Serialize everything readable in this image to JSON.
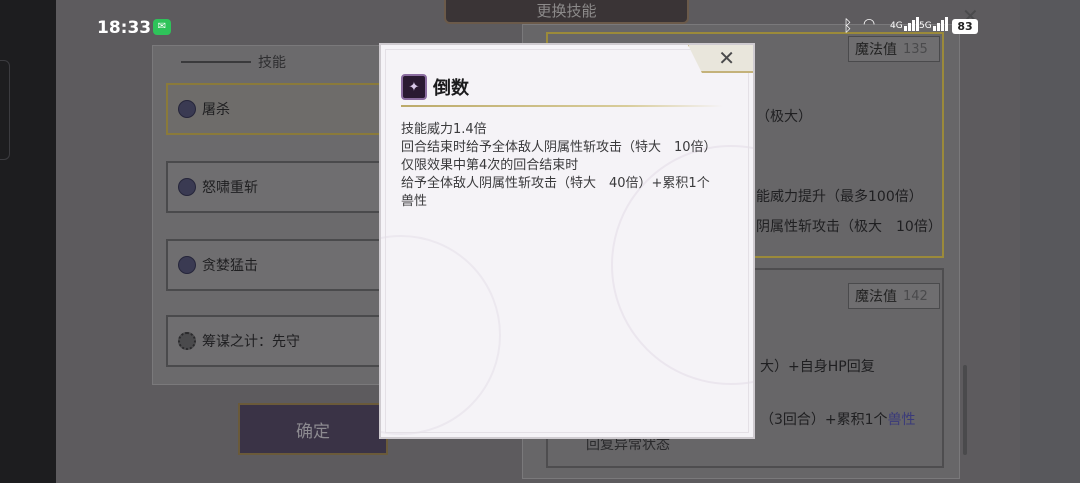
{
  "status_bar": {
    "time": "18:33",
    "wechat_icon": "wechat-icon",
    "signal_4g": "4G",
    "signal_5g": "5G",
    "battery": "83"
  },
  "screen": {
    "title": "更换技能"
  },
  "left_panel": {
    "header": "技能",
    "skills": [
      {
        "label": "屠杀",
        "icon": "crescent-icon"
      },
      {
        "label": "怒啸重斩",
        "icon": "crescent-icon"
      },
      {
        "label": "贪婪猛击",
        "icon": "crescent-icon"
      },
      {
        "label": "筹谋之计：先守",
        "icon": "gear-icon"
      }
    ],
    "confirm_label": "确定"
  },
  "right_panel": {
    "mp_label_1": "魔法值",
    "mp_value_1": "135",
    "text_1": "（极大）",
    "text_2": "能威力提升（最多100倍）",
    "text_3": "阴属性斩攻击（极大　10倍）",
    "mp_label_2": "魔法值",
    "mp_value_2": "142",
    "text_4": "大）+自身HP回复",
    "text_5_a": "（3回合）+累积1个",
    "text_5_b": "兽性",
    "text_6": "回复异常状态"
  },
  "modal": {
    "title": "倒数",
    "close_icon": "close-icon",
    "lines": [
      "技能威力1.4倍",
      "回合结束时给予全体敌人阴属性斩攻击（特大　10倍）",
      "仅限效果中第4次的回合结束时",
      "给予全体敌人阴属性斩攻击（特大　40倍）+累积1个",
      "兽性"
    ]
  }
}
